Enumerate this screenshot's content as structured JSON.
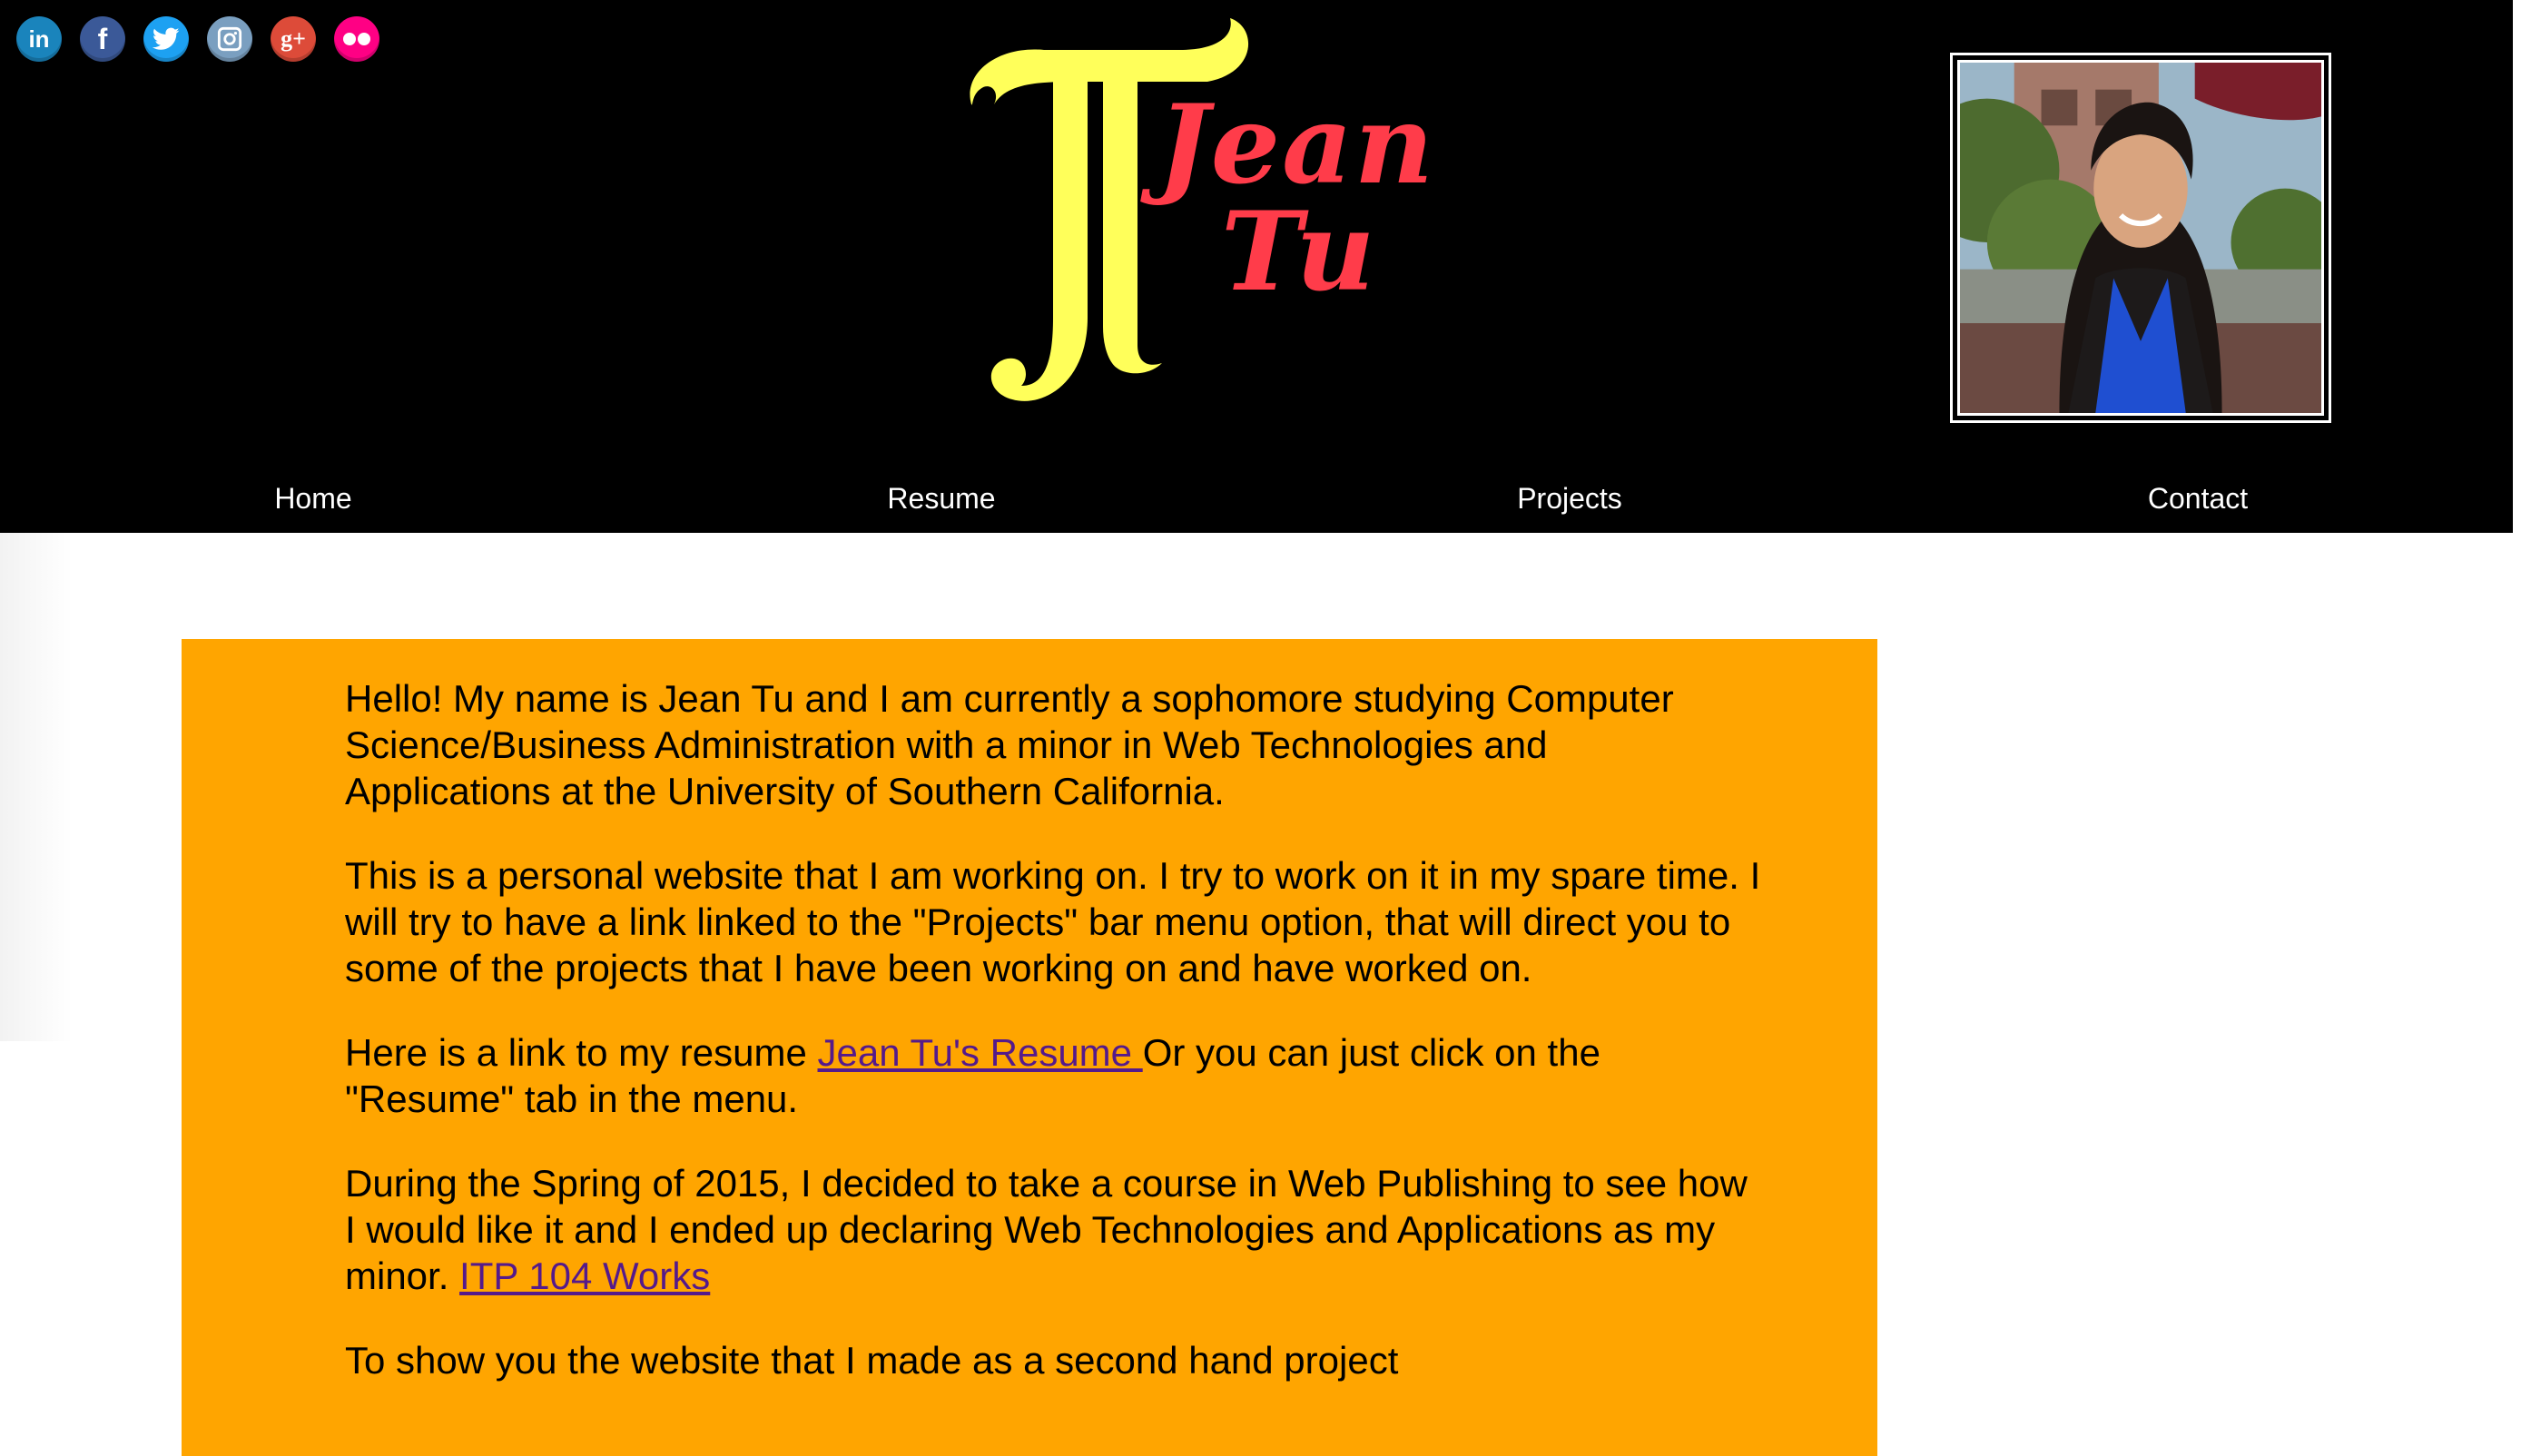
{
  "social": {
    "icons": [
      {
        "name": "linkedin-icon",
        "glyph": "in",
        "color": "#1a84bc"
      },
      {
        "name": "facebook-icon",
        "glyph": "f",
        "color": "#3b5998"
      },
      {
        "name": "twitter-icon",
        "glyph": "",
        "color": "#1da1f2"
      },
      {
        "name": "instagram-icon",
        "glyph": "",
        "color": "#7a9fc0"
      },
      {
        "name": "google-plus-icon",
        "glyph": "g+",
        "color": "#dd4b39"
      },
      {
        "name": "flickr-icon",
        "glyph": "",
        "color": "#ff0084"
      }
    ]
  },
  "logo": {
    "monogram": "JT",
    "first": "Jean",
    "last": "Tu",
    "monogram_color": "#ffff5a",
    "text_color": "#ff3c4a"
  },
  "profile_photo": {
    "label": "Profile photo of Jean Tu"
  },
  "nav": {
    "items": [
      {
        "label": "Home"
      },
      {
        "label": "Resume"
      },
      {
        "label": "Projects"
      },
      {
        "label": "Contact"
      }
    ]
  },
  "content": {
    "p1": "Hello! My name is Jean Tu and I am currently a sophomore studying Computer Science/Business Administration with a minor in Web Technologies and Applications at the University of Southern California.",
    "p2": "This is a personal website that I am working on. I try to work on it in my spare time. I will try to have a link linked to the \"Projects\" bar menu option, that will direct you to some of the projects that I have been working on and have worked on.",
    "p3_before": "Here is a link to my resume ",
    "p3_link": "Jean Tu's Resume ",
    "p3_after": "Or you can just click on the \"Resume\" tab in the menu.",
    "p4_before": "During the Spring of 2015, I decided to take a course in Web Publishing to see how I would like it and I ended up declaring Web Technologies and Applications as my minor. ",
    "p4_link": "ITP 104 Works",
    "p5_partial": "To show you the website that I made as a second hand project"
  },
  "colors": {
    "header_bg": "#000000",
    "content_bg": "#ffa500",
    "link": "#551a8b"
  }
}
